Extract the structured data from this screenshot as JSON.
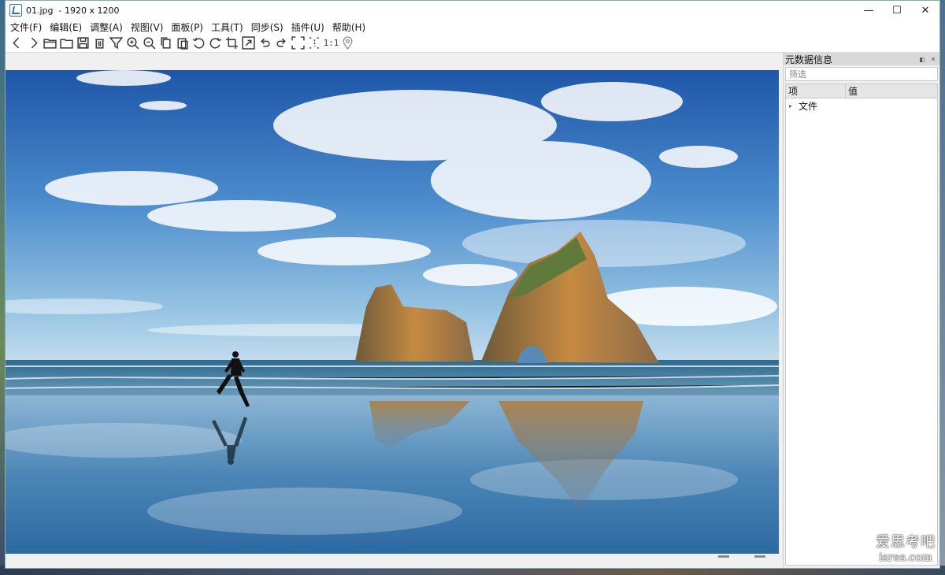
{
  "titlebar": {
    "title": "01.jpg  - 1920 x 1200",
    "minimize": "—",
    "maximize": "☐",
    "close": "✕"
  },
  "menu": [
    {
      "label": "文件(F)"
    },
    {
      "label": "编辑(E)"
    },
    {
      "label": "调整(A)"
    },
    {
      "label": "视图(V)"
    },
    {
      "label": "面板(P)"
    },
    {
      "label": "工具(T)"
    },
    {
      "label": "同步(S)"
    },
    {
      "label": "插件(U)"
    },
    {
      "label": "帮助(H)"
    }
  ],
  "toolbar": {
    "icons": [
      "prev-icon",
      "next-icon",
      "open-folder-icon",
      "folder-icon",
      "save-icon",
      "delete-icon",
      "filter-icon",
      "zoom-in-icon",
      "zoom-out-icon",
      "copy-icon",
      "paste-icon",
      "rotate-left-icon",
      "rotate-right-icon",
      "crop-icon",
      "resize-icon",
      "undo-icon",
      "redo-icon",
      "fullscreen-icon",
      "fit-icon",
      "actual-size-icon",
      "location-pin-icon"
    ],
    "actual_size_label": "1:1"
  },
  "panel": {
    "title": "元数据信息",
    "filter_placeholder": "筛选",
    "columns": [
      "项",
      "值"
    ],
    "rows": [
      {
        "label": "文件",
        "expanded": false
      }
    ]
  },
  "watermark": {
    "line1": "爱思考吧",
    "line2": "isres.com"
  },
  "colors": {
    "sky_top": "#2a5fae",
    "sky_horizon": "#8fc0e0",
    "sea": "#3a6f96",
    "rock": "#b07a3a"
  }
}
